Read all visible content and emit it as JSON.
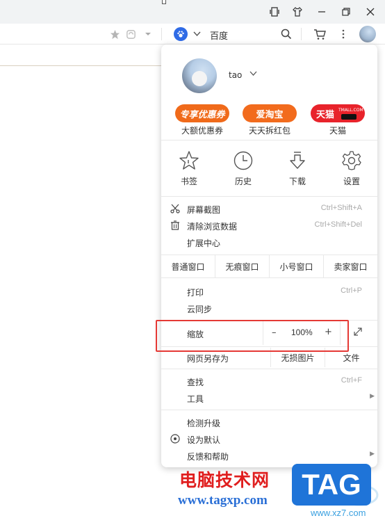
{
  "window": {
    "buttons": [
      "reader-icon",
      "shirt-icon",
      "minimize-icon",
      "restore-icon",
      "close-icon"
    ]
  },
  "toolbar": {
    "search_engine_label": "百度",
    "icons": [
      "star-icon",
      "refresh-icon",
      "dropdown-icon",
      "paw-icon",
      "chevron-down-icon",
      "search-icon",
      "cart-icon",
      "more-icon",
      "avatar-icon"
    ]
  },
  "menu": {
    "user_name": "tao",
    "promos": [
      {
        "badge": "专享优惠券",
        "label": "大额优惠券",
        "color": "#f06a1a"
      },
      {
        "badge": "爱淘宝",
        "label": "天天拆红包",
        "color": "#f26b1d"
      },
      {
        "badge": "天猫",
        "sub": "TMALL.COM",
        "label": "天猫",
        "color": "#e8232b"
      }
    ],
    "quick_actions": [
      {
        "label": "书签",
        "icon": "bookmark-star-icon"
      },
      {
        "label": "历史",
        "icon": "clock-icon"
      },
      {
        "label": "下载",
        "icon": "download-icon"
      },
      {
        "label": "设置",
        "icon": "gear-icon"
      }
    ],
    "tools": [
      {
        "label": "屏幕截图",
        "shortcut": "Ctrl+Shift+A",
        "icon": "scissors-icon"
      },
      {
        "label": "清除浏览数据",
        "shortcut": "Ctrl+Shift+Del",
        "icon": "trash-icon"
      },
      {
        "label": "扩展中心",
        "shortcut": "",
        "icon": ""
      }
    ],
    "windows": [
      "普通窗口",
      "无痕窗口",
      "小号窗口",
      "卖家窗口"
    ],
    "print": {
      "label": "打印",
      "shortcut": "Ctrl+P"
    },
    "sync": {
      "label": "云同步"
    },
    "zoom": {
      "label": "缩放",
      "minus": "–",
      "value": "100%",
      "plus": "+"
    },
    "save": {
      "label": "网页另存为",
      "lossless": "无损图片",
      "file": "文件"
    },
    "find": {
      "label": "查找",
      "shortcut": "Ctrl+F"
    },
    "tools_sub": {
      "label": "工具"
    },
    "update": {
      "label": "检测升级"
    },
    "default": {
      "label": "设为默认"
    },
    "help": {
      "label": "反馈和帮助"
    }
  },
  "watermark": {
    "title": "电脑技术网",
    "url": "www.tagxp.com",
    "tag": "TAG",
    "site": "www.xz7.com"
  }
}
